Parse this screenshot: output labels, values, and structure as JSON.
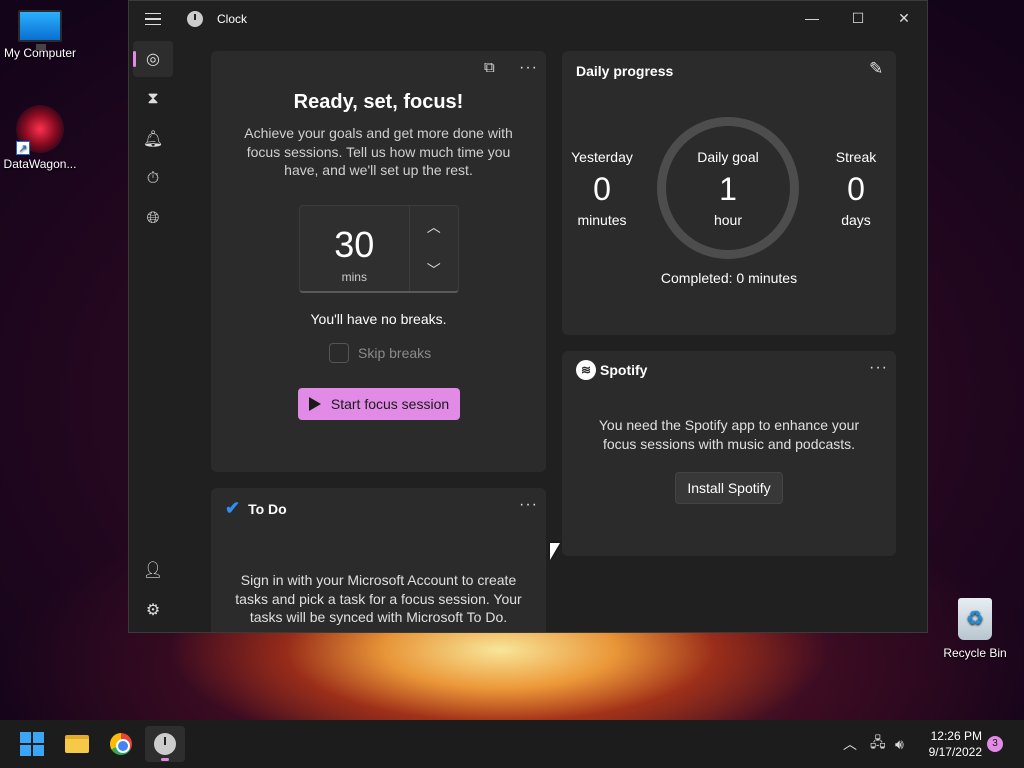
{
  "desktop": {
    "icons": [
      {
        "label": "My Computer"
      },
      {
        "label": "DataWagon..."
      },
      {
        "label": "Recycle Bin"
      }
    ]
  },
  "window": {
    "title": "Clock",
    "controls": {
      "minimize": "—",
      "maximize": "☐",
      "close": "✕"
    }
  },
  "nav": {
    "items": [
      "focus-sessions",
      "timer",
      "alarm",
      "stopwatch",
      "world-clock"
    ],
    "bottom": [
      "account",
      "settings"
    ]
  },
  "focus": {
    "title": "Ready, set, focus!",
    "description": "Achieve your goals and get more done with focus sessions. Tell us how much time you have, and we'll set up the rest.",
    "minutes": "30",
    "unit": "mins",
    "breaks_text": "You'll have no breaks.",
    "skip_label": "Skip breaks",
    "start_label": "Start focus session"
  },
  "progress": {
    "title": "Daily progress",
    "yesterday": {
      "label": "Yesterday",
      "value": "0",
      "unit": "minutes"
    },
    "goal": {
      "label": "Daily goal",
      "value": "1",
      "unit": "hour"
    },
    "streak": {
      "label": "Streak",
      "value": "0",
      "unit": "days"
    },
    "completed": "Completed: 0 minutes"
  },
  "spotify": {
    "brand": "Spotify",
    "message": "You need the Spotify app to enhance your focus sessions with music and podcasts.",
    "install_label": "Install Spotify"
  },
  "todo": {
    "title": "To Do",
    "message": "Sign in with your Microsoft Account to create tasks and pick a task for a focus session. Your tasks will be synced with Microsoft To Do."
  },
  "taskbar": {
    "time": "12:26 PM",
    "date": "9/17/2022",
    "notifications": "3"
  },
  "colors": {
    "accent": "#e28be6",
    "card": "#2b2b2b",
    "window": "#202020"
  }
}
